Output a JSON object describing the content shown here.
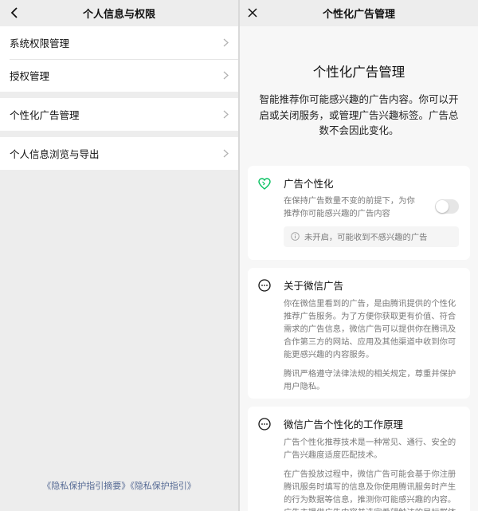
{
  "left": {
    "header": {
      "title": "个人信息与权限",
      "back_icon": "chevron-left-icon"
    },
    "items": [
      {
        "label": "系统权限管理"
      },
      {
        "label": "授权管理"
      },
      {
        "label": "个性化广告管理"
      },
      {
        "label": "个人信息浏览与导出"
      }
    ],
    "footer_link": "《隐私保护指引摘要》《隐私保护指引》"
  },
  "right": {
    "header": {
      "title": "个性化广告管理",
      "close_icon": "close-icon"
    },
    "hero": {
      "title": "个性化广告管理",
      "description": "智能推荐你可能感兴趣的广告内容。你可以开启或关闭服务，或管理广告兴趣标签。广告总数不会因此变化。"
    },
    "card_personalization": {
      "title": "广告个性化",
      "description": "在保持广告数量不变的前提下，为你推荐你可能感兴趣的广告内容",
      "toggle_on": false,
      "notice": "未开启，可能收到不感兴趣的广告"
    },
    "card_about": {
      "title": "关于微信广告",
      "paragraph1": "你在微信里看到的广告，是由腾讯提供的个性化推荐广告服务。为了方便你获取更有价值、符合需求的广告信息，微信广告可以提供你在腾讯及合作第三方的网站、应用及其他渠道中收到你可能更感兴趣的内容服务。",
      "paragraph2": "腾讯严格遵守法律法规的相关规定，尊重并保护用户隐私。"
    },
    "card_principle": {
      "title": "微信广告个性化的工作原理",
      "paragraph1": "广告个性化推荐技术是一种常见、通行、安全的广告兴趣度适度匹配技术。",
      "paragraph2": "在广告投放过程中，微信广告可能会基于你注册腾讯服务时填写的信息及你使用腾讯服务时产生的行为数据等信息，推测你可能感兴趣的内容。广告主提供广告内容并选定希望触达的目标群体类型，由微信广告系统自动化地将广告投放给该"
    }
  },
  "colors": {
    "link": "#576b95",
    "accent_green": "#07c160",
    "background": "#ededed"
  }
}
